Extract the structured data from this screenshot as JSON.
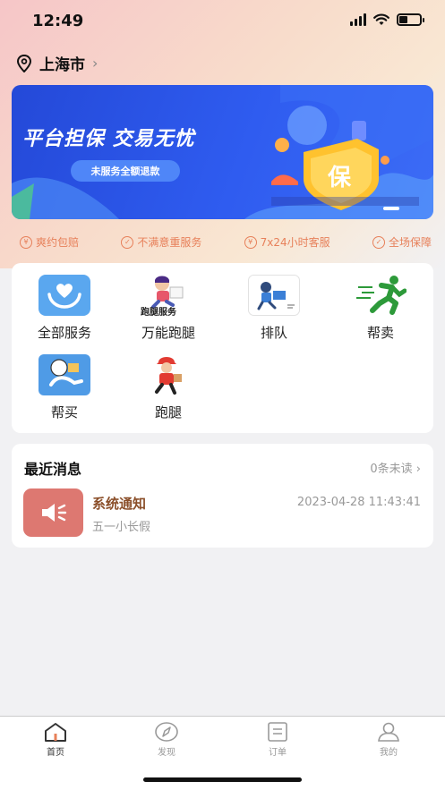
{
  "status_bar": {
    "time": "12:49"
  },
  "location": {
    "city": "上海市"
  },
  "banner": {
    "title": "平台担保 交易无忧",
    "button": "未服务全额退款",
    "badge_char": "保"
  },
  "guarantees": [
    {
      "icon": "cash-icon",
      "icon_text": "(€)",
      "label": "爽约包赔"
    },
    {
      "icon": "check-circle-icon",
      "label": "不满意重服务"
    },
    {
      "icon": "yuan-icon",
      "label": "7x24小时客服"
    },
    {
      "icon": "check-circle-icon",
      "label": "全场保障"
    }
  ],
  "services": [
    {
      "label": "全部服务",
      "icon": "hands-heart-icon"
    },
    {
      "label": "万能跑腿",
      "icon": "runner-cartoon-icon",
      "icon_caption": "跑腿服务"
    },
    {
      "label": "排队",
      "icon": "queue-courier-icon"
    },
    {
      "label": "帮卖",
      "icon": "green-runner-icon"
    },
    {
      "label": "帮买",
      "icon": "shopping-runner-icon"
    },
    {
      "label": "跑腿",
      "icon": "delivery-man-icon"
    }
  ],
  "messages": {
    "header": "最近消息",
    "unread": "0条未读",
    "items": [
      {
        "title": "系统通知",
        "time": "2023-04-28 11:43:41",
        "preview": "五一小长假",
        "icon": "speaker-icon"
      }
    ]
  },
  "tabbar": [
    {
      "label": "首页",
      "icon": "home-icon",
      "active": true
    },
    {
      "label": "发现",
      "icon": "compass-icon",
      "active": false
    },
    {
      "label": "订单",
      "icon": "order-icon",
      "active": false
    },
    {
      "label": "我的",
      "icon": "user-icon",
      "active": false
    }
  ],
  "colors": {
    "accent_orange": "#e7805a",
    "banner_blue": "#2f5cf0",
    "message_icon": "#dd7871",
    "message_title": "#8b4f2a"
  }
}
